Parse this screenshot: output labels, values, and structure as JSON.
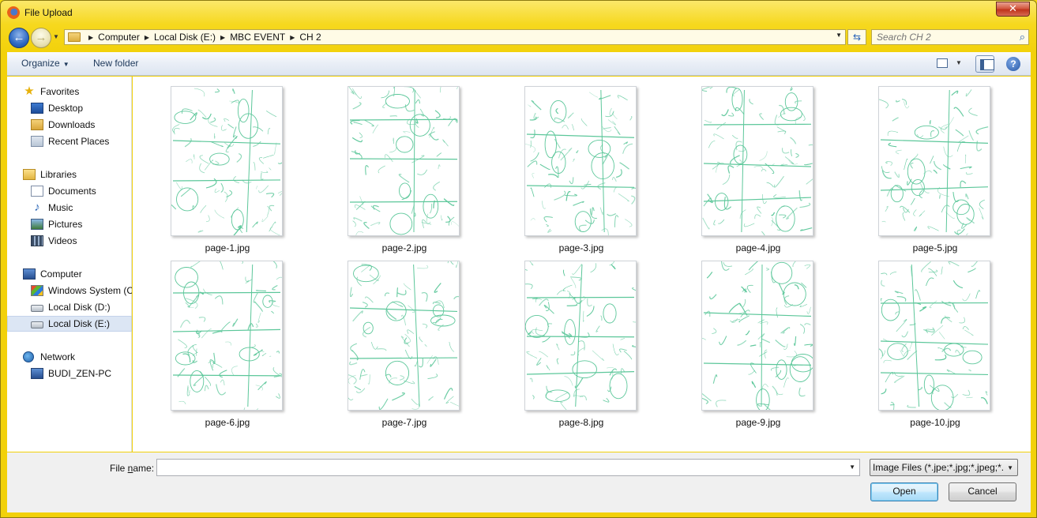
{
  "window": {
    "title": "File Upload",
    "close_label": "✕"
  },
  "address": {
    "crumbs": [
      "Computer",
      "Local Disk (E:)",
      "MBC EVENT",
      "CH 2"
    ]
  },
  "search": {
    "placeholder": "Search CH 2"
  },
  "toolbar": {
    "organize_label": "Organize",
    "new_folder_label": "New folder",
    "help_label": "?"
  },
  "sidebar": {
    "favorites_label": "Favorites",
    "desktop_label": "Desktop",
    "downloads_label": "Downloads",
    "recent_label": "Recent Places",
    "libraries_label": "Libraries",
    "documents_label": "Documents",
    "music_label": "Music",
    "pictures_label": "Pictures",
    "videos_label": "Videos",
    "computer_label": "Computer",
    "windows_label": "Windows System (C:)",
    "diskd_label": "Local Disk (D:)",
    "diske_label": "Local Disk (E:)",
    "network_label": "Network",
    "pc_label": "BUDI_ZEN-PC"
  },
  "files": [
    {
      "name": "page-1.jpg"
    },
    {
      "name": "page-2.jpg"
    },
    {
      "name": "page-3.jpg"
    },
    {
      "name": "page-4.jpg"
    },
    {
      "name": "page-5.jpg"
    },
    {
      "name": "page-6.jpg"
    },
    {
      "name": "page-7.jpg"
    },
    {
      "name": "page-8.jpg"
    },
    {
      "name": "page-9.jpg"
    },
    {
      "name": "page-10.jpg"
    }
  ],
  "bottom": {
    "file_name_label_pre": "File ",
    "file_name_label_u": "n",
    "file_name_label_post": "ame:",
    "file_name_value": "",
    "file_type_value": "Image Files (*.jpe;*.jpg;*.jpeg;*.",
    "open_label": "Open",
    "cancel_label": "Cancel"
  },
  "colors": {
    "sketch": "#5cc79a",
    "accent": "#f2d10a"
  }
}
